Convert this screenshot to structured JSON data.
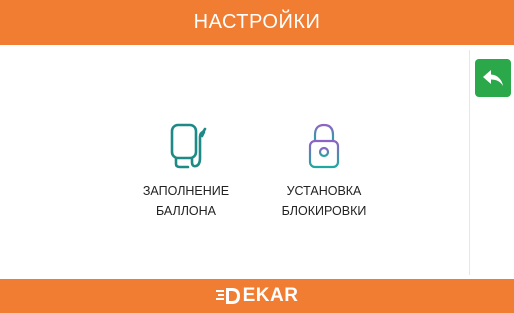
{
  "header": {
    "title": "НАСТРОЙКИ"
  },
  "toolbar": {
    "back_icon": "undo-arrow-icon"
  },
  "tiles": [
    {
      "id": "cylinder-fill",
      "icon": "water-tank-icon",
      "line1": "ЗАПОЛНЕНИЕ",
      "line2": "БАЛЛОНА",
      "icon_color": "#1E8A85"
    },
    {
      "id": "lock-setup",
      "icon": "padlock-icon",
      "line1": "УСТАНОВКА",
      "line2": "БЛОКИРОВКИ",
      "icon_color": "#7C5AB5"
    }
  ],
  "footer": {
    "brand": "EKAR",
    "brand_mark": "D"
  },
  "colors": {
    "accent": "#F07D32",
    "back_button": "#2BA84A",
    "background": "#FFFFFF"
  }
}
